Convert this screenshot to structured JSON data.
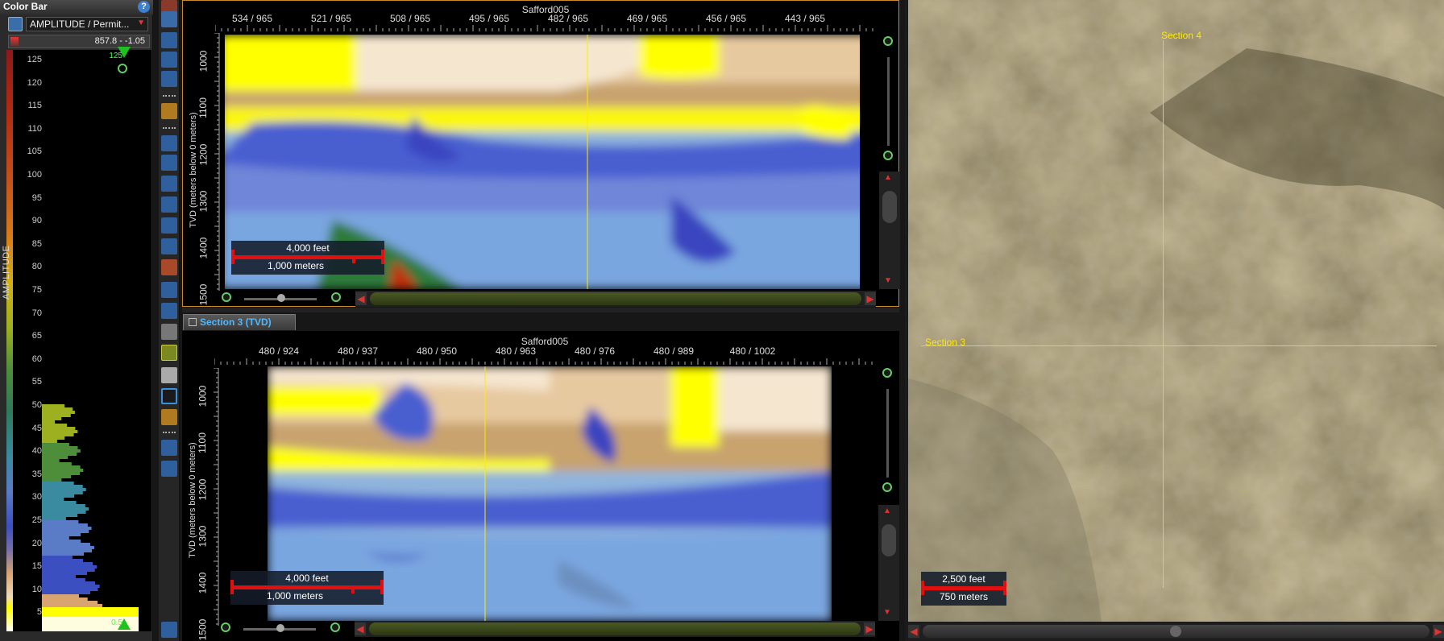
{
  "colorbar": {
    "title": "Color Bar",
    "help_label": "?",
    "selected_attribute": "AMPLITUDE / Permit...",
    "range_text": "857.8 - -1.05",
    "axis_title": "AMPLITUDE",
    "top_value": "125",
    "bottom_value": "0.5",
    "ticks": [
      "125",
      "120",
      "115",
      "110",
      "105",
      "100",
      "95",
      "90",
      "85",
      "80",
      "75",
      "70",
      "65",
      "60",
      "55",
      "50",
      "45",
      "40",
      "35",
      "30",
      "25",
      "20",
      "15",
      "10",
      "5"
    ]
  },
  "section_top": {
    "title": "Safford005",
    "x_ticks": [
      "534 / 965",
      "521 / 965",
      "508 / 965",
      "495 / 965",
      "482 / 965",
      "469 / 965",
      "456 / 965",
      "443 / 965"
    ],
    "y_axis_title": "TVD (meters below 0 meters)",
    "y_ticks": [
      "1000",
      "1100",
      "1200",
      "1300",
      "1400",
      "1500"
    ],
    "scalebar": {
      "top": "4,000 feet",
      "bottom": "1,000 meters"
    }
  },
  "section_bottom": {
    "tab_label": "Section 3 (TVD)",
    "title": "Safford005",
    "x_ticks": [
      "480 / 924",
      "480 / 937",
      "480 / 950",
      "480 / 963",
      "480 / 976",
      "480 / 989",
      "480 / 1002"
    ],
    "y_axis_title": "TVD (meters below 0 meters)",
    "y_ticks": [
      "1000",
      "1100",
      "1200",
      "1300",
      "1400",
      "1500"
    ],
    "scalebar": {
      "top": "4,000 feet",
      "bottom": "1,000 meters"
    }
  },
  "map": {
    "label_section4": "Section 4",
    "label_section3": "Section 3",
    "scalebar": {
      "top": "2,500 feet",
      "bottom": "750 meters"
    }
  },
  "colors": {
    "section_line": "#ffea00",
    "scalebar_red": "#e01010",
    "active_frame": "#c88a2c"
  }
}
